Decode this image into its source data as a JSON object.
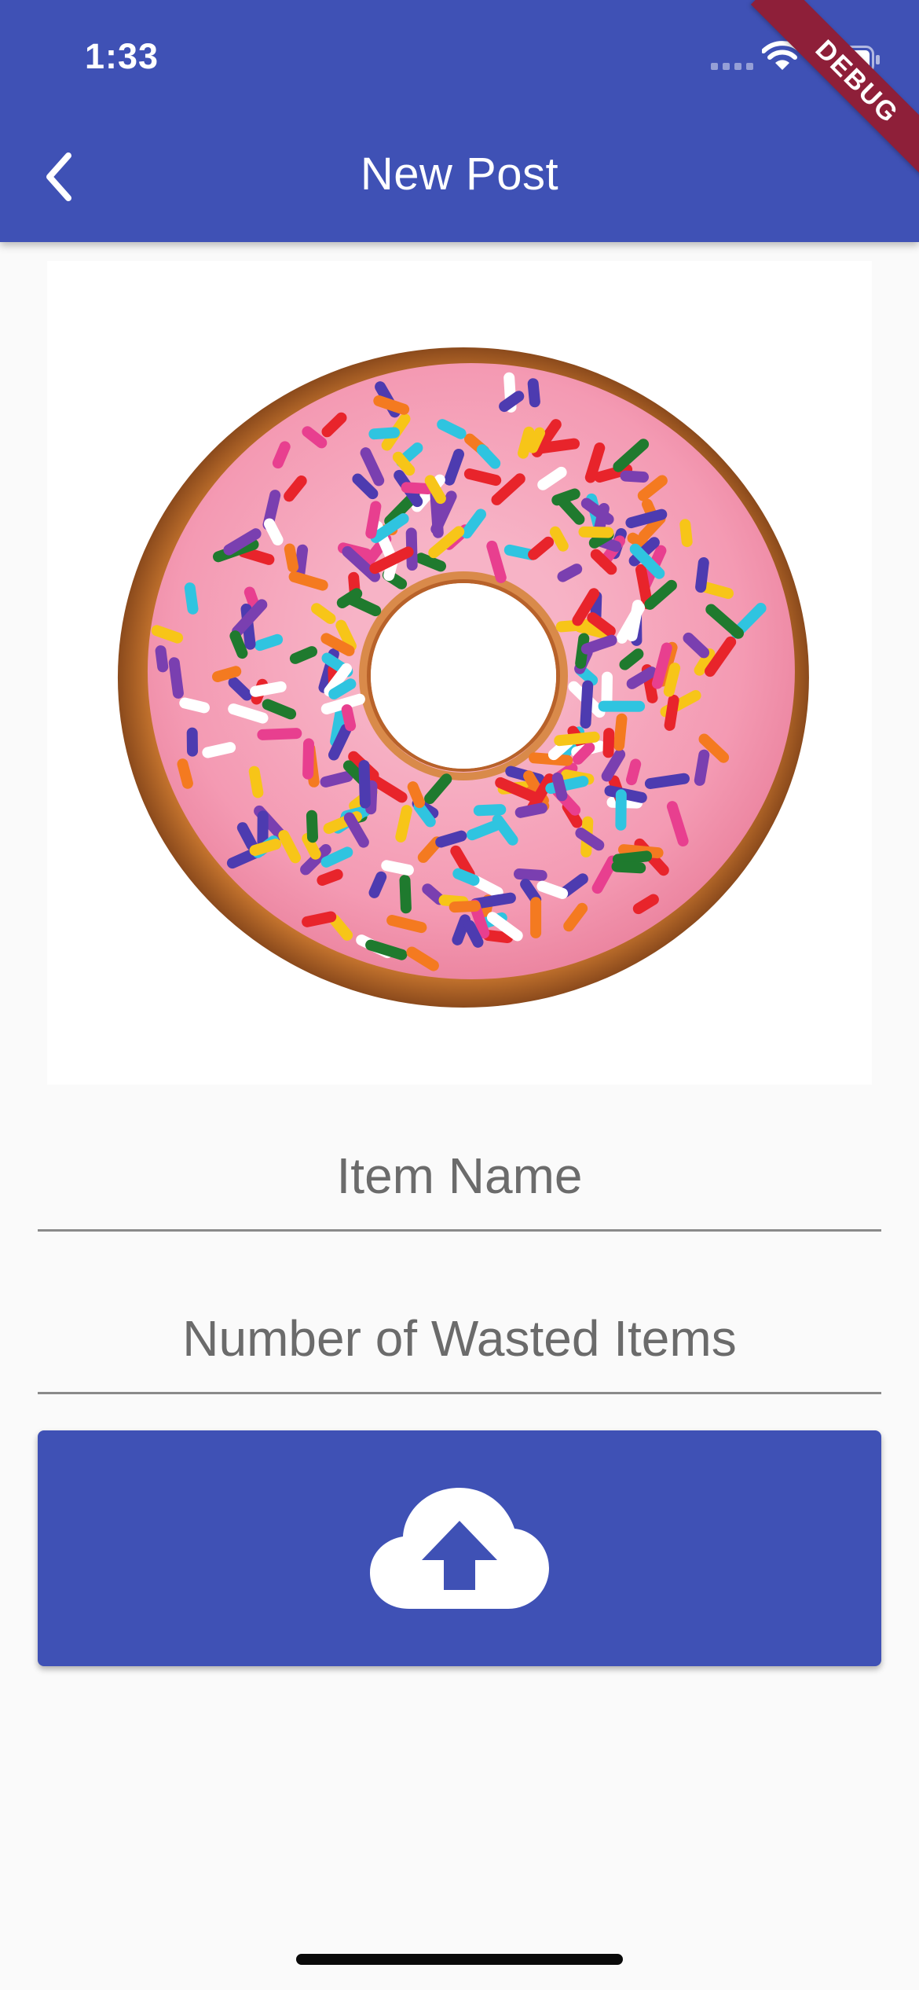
{
  "status_bar": {
    "time": "1:33"
  },
  "app_bar": {
    "title": "New Post",
    "back_icon": "chevron-left-icon",
    "background_color": "#3f51b5"
  },
  "debug_banner": {
    "label": "DEBUG"
  },
  "post_image": {
    "subject": "pink-frosted-donut-with-sprinkles"
  },
  "form": {
    "item_name": {
      "value": "",
      "placeholder": "Item Name"
    },
    "wasted_quantity": {
      "value": "",
      "placeholder": "Number of Wasted Items"
    }
  },
  "upload_button": {
    "icon": "cloud-upload-icon",
    "background_color": "#3f51b5"
  }
}
